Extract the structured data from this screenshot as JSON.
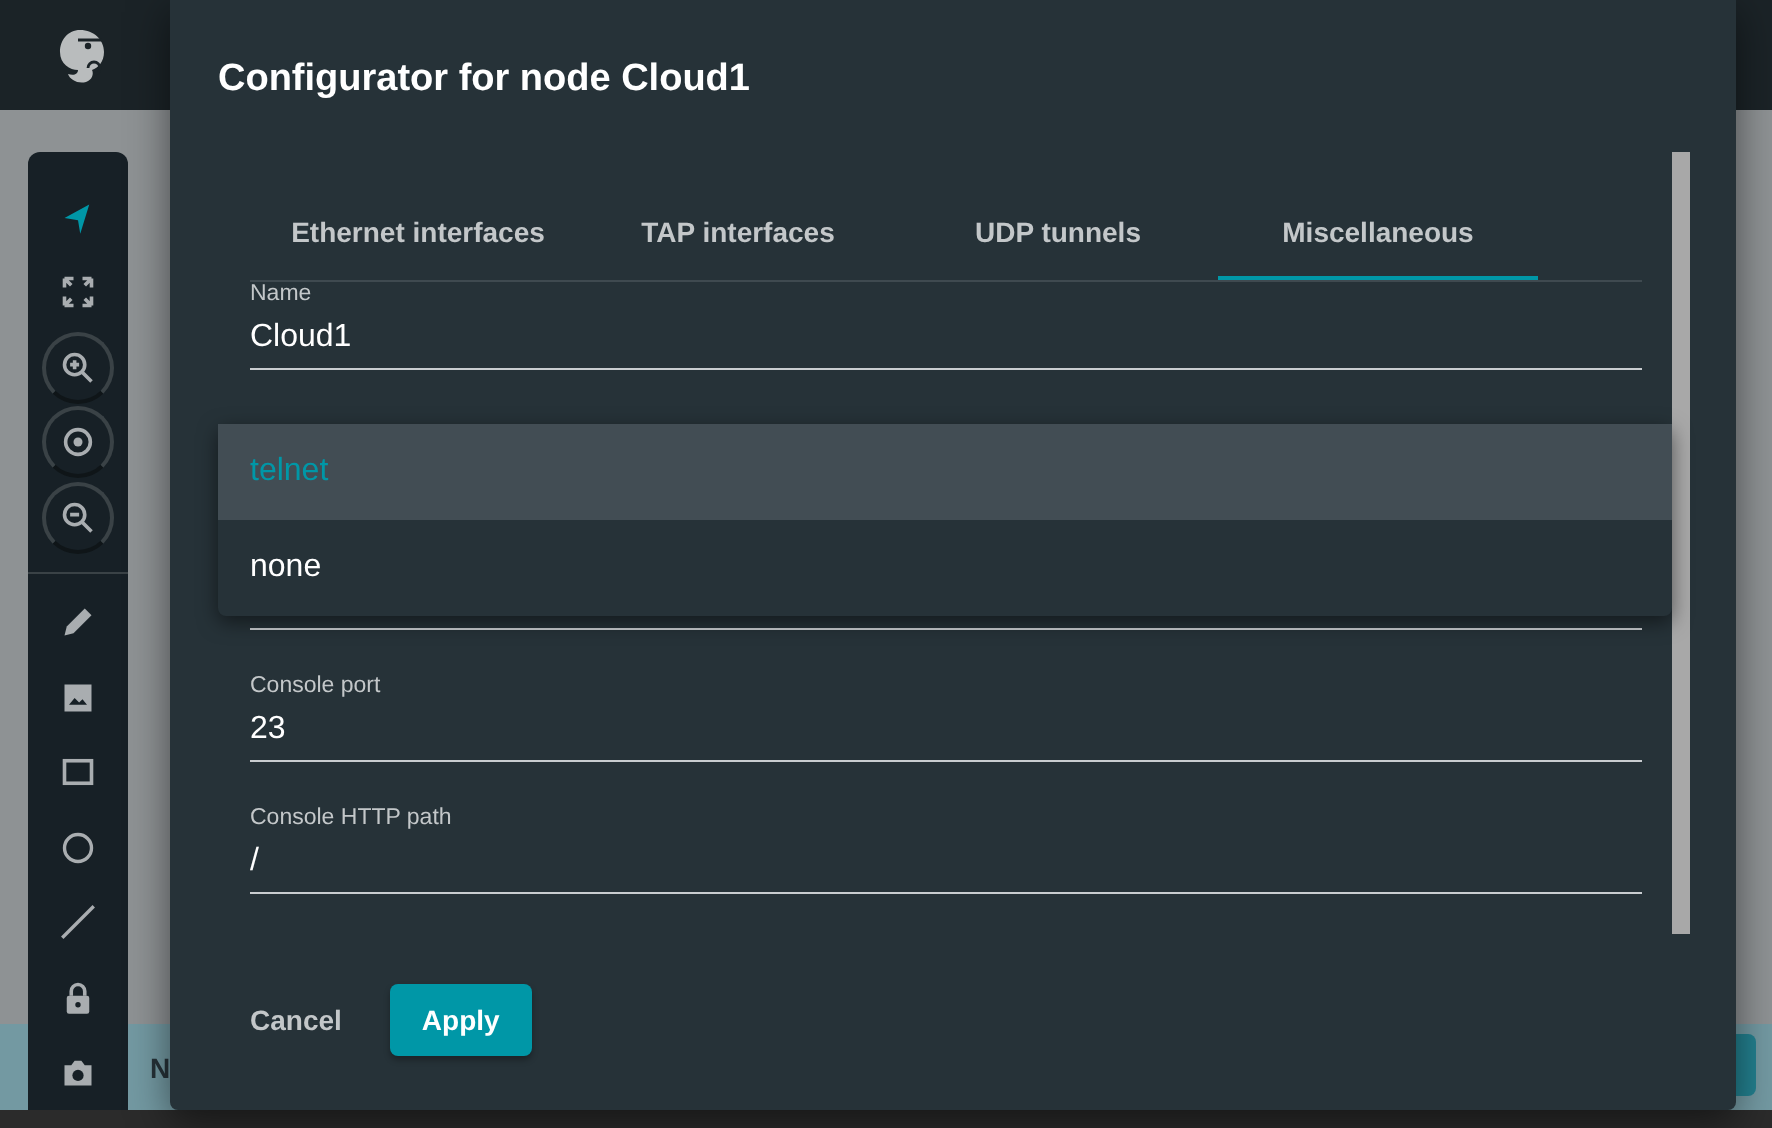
{
  "toolbar": {
    "tools": [
      {
        "kind": "pointer",
        "selected": true
      },
      {
        "kind": "fit",
        "selected": false
      },
      {
        "kind": "zoom-in",
        "selected": false
      },
      {
        "kind": "reset",
        "selected": false
      },
      {
        "kind": "zoom-out",
        "selected": false
      },
      {
        "kind": "pencil",
        "selected": false
      },
      {
        "kind": "image",
        "selected": false
      },
      {
        "kind": "rectangle",
        "selected": false
      },
      {
        "kind": "ellipse",
        "selected": false
      },
      {
        "kind": "line",
        "selected": false
      },
      {
        "kind": "lock",
        "selected": false
      },
      {
        "kind": "camera",
        "selected": false
      }
    ]
  },
  "status_bar": {
    "text": "N"
  },
  "dialog": {
    "title": "Configurator for node Cloud1",
    "tabs": [
      {
        "label": "Ethernet interfaces",
        "selected": false
      },
      {
        "label": "TAP interfaces",
        "selected": false
      },
      {
        "label": "UDP tunnels",
        "selected": false
      },
      {
        "label": "Miscellaneous",
        "selected": true
      }
    ],
    "fields": [
      {
        "label": "Name",
        "value": "Cloud1"
      },
      {
        "kind": "covered"
      },
      {
        "label": "Console port",
        "value": "23"
      },
      {
        "label": "Console HTTP path",
        "value": "/"
      }
    ],
    "dropdown": {
      "options": [
        {
          "label": "telnet",
          "selected": true
        },
        {
          "label": "none",
          "selected": false
        }
      ]
    },
    "buttons": [
      {
        "label": "Cancel",
        "kind": "flat"
      },
      {
        "label": "Apply",
        "kind": "raised"
      }
    ]
  }
}
